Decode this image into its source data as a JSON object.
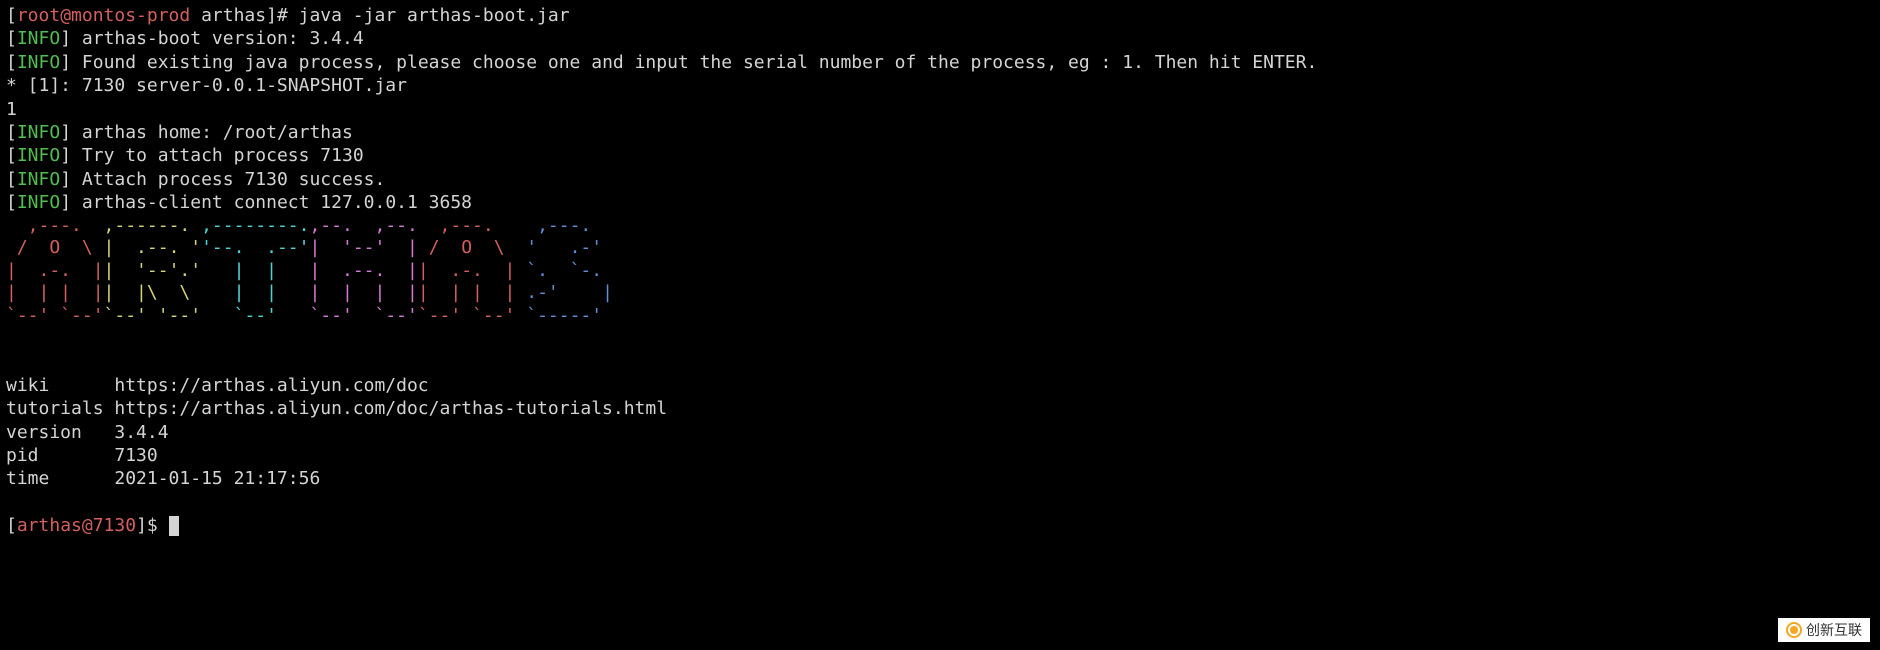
{
  "prompt1": {
    "bracket_open": "[",
    "user": "root@montos-prod",
    "path": " arthas",
    "bracket_close": "]",
    "hash": "# ",
    "command": "java -jar arthas-boot.jar"
  },
  "logs": {
    "info_tag_open": "[",
    "info_tag": "INFO",
    "info_tag_close": "] ",
    "line1": "arthas-boot version: 3.4.4",
    "line2": "Found existing java process, please choose one and input the serial number of the process, eg : 1. Then hit ENTER.",
    "process_list": "* [1]: 7130 server-0.0.1-SNAPSHOT.jar",
    "user_input": "1",
    "line3": "arthas home: /root/arthas",
    "line4": "Try to attach process 7130",
    "line5": "Attach process 7130 success.",
    "line6": "arthas-client connect 127.0.0.1 3658"
  },
  "info": {
    "wiki_label": "wiki      ",
    "wiki_url": "https://arthas.aliyun.com/doc",
    "tutorials_label": "tutorials ",
    "tutorials_url": "https://arthas.aliyun.com/doc/arthas-tutorials.html",
    "version_label": "version   ",
    "version_value": "3.4.4",
    "pid_label": "pid       ",
    "pid_value": "7130",
    "time_label": "time      ",
    "time_value": "2021-01-15 21:17:56"
  },
  "prompt2": {
    "bracket_open": "[",
    "user": "arthas@7130",
    "bracket_close": "]",
    "dollar": "$ "
  },
  "watermark": "创新互联"
}
